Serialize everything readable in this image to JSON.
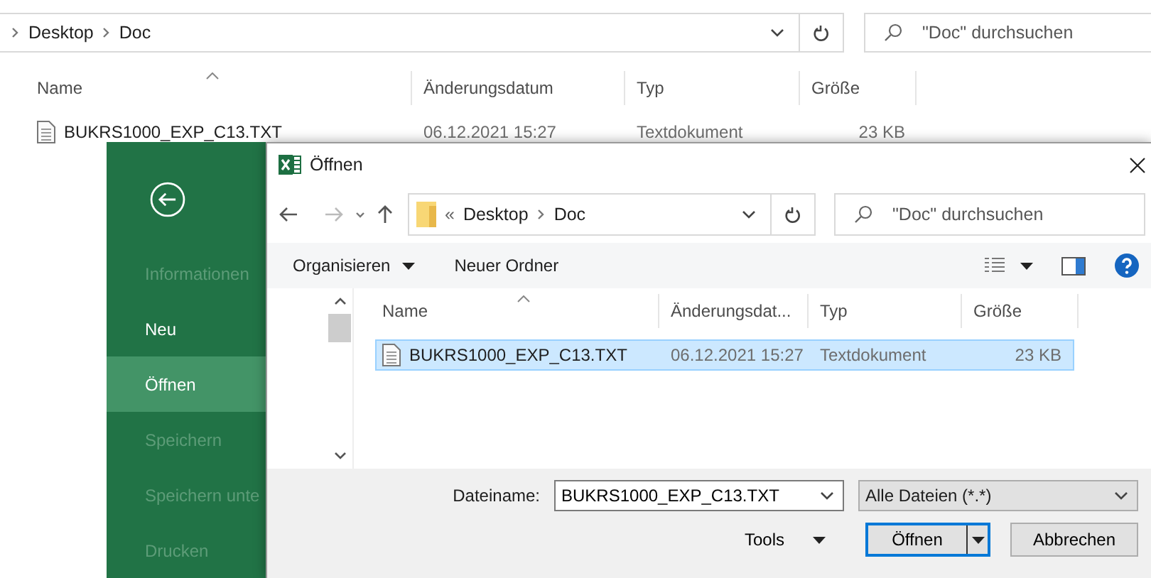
{
  "explorer": {
    "breadcrumb": [
      "Desktop",
      "Doc"
    ],
    "search": {
      "placeholder": "\"Doc\" durchsuchen"
    },
    "columns": [
      "Name",
      "Änderungsdatum",
      "Typ",
      "Größe"
    ],
    "rows": [
      {
        "name": "BUKRS1000_EXP_C13.TXT",
        "date": "06.12.2021 15:27",
        "type": "Textdokument",
        "size": "23 KB"
      }
    ]
  },
  "backstage": {
    "items": [
      {
        "label": "Informationen",
        "disabled": true,
        "selected": false
      },
      {
        "label": "Neu",
        "disabled": false,
        "selected": false
      },
      {
        "label": "Öffnen",
        "disabled": false,
        "selected": true
      },
      {
        "label": "Speichern",
        "disabled": true,
        "selected": false
      },
      {
        "label": "Speichern unte",
        "disabled": true,
        "selected": false
      },
      {
        "label": "Drucken",
        "disabled": true,
        "selected": false
      }
    ]
  },
  "dialog": {
    "title": "Öffnen",
    "overflow": "«",
    "breadcrumb": [
      "Desktop",
      "Doc"
    ],
    "search": {
      "placeholder": "\"Doc\" durchsuchen"
    },
    "toolbar": [
      {
        "label": "Organisieren",
        "kind": "menu"
      },
      {
        "label": "Neuer Ordner",
        "kind": "button"
      }
    ],
    "columns": [
      "Name",
      "Änderungsdat...",
      "Typ",
      "Größe"
    ],
    "rows": [
      {
        "name": "BUKRS1000_EXP_C13.TXT",
        "date": "06.12.2021 15:27",
        "type": "Textdokument",
        "size": "23 KB",
        "selected": true
      }
    ],
    "filename_label": "Dateiname:",
    "filename": "BUKRS1000_EXP_C13.TXT",
    "filter": "Alle Dateien (*.*)",
    "tools": "Tools",
    "buttons": [
      {
        "label": "Öffnen",
        "kind": "split",
        "default": true
      },
      {
        "label": "Abbrechen",
        "kind": "plain",
        "default": false
      }
    ]
  }
}
